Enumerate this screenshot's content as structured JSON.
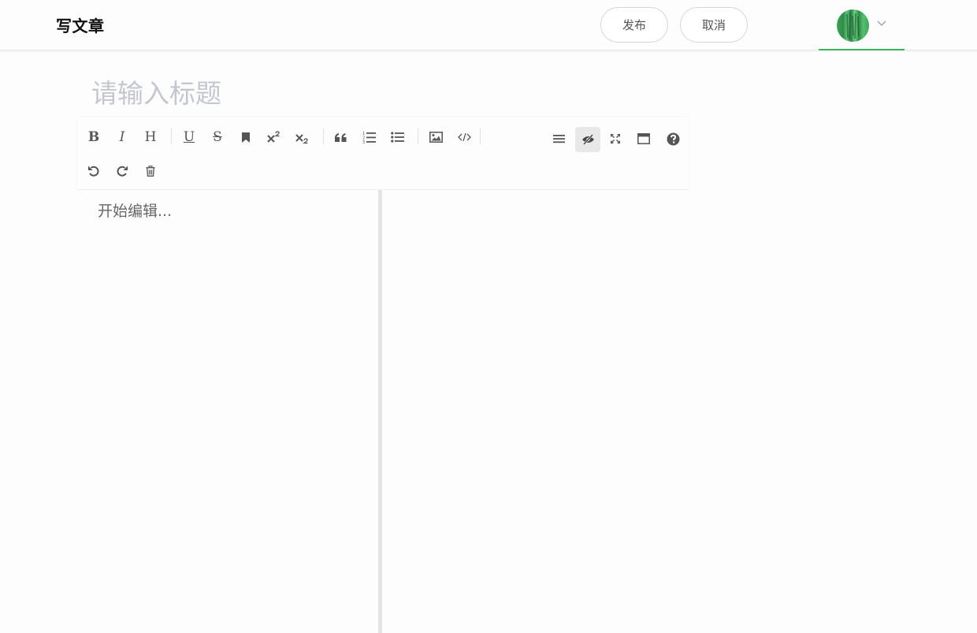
{
  "header": {
    "title": "写文章",
    "publish_label": "发布",
    "cancel_label": "取消",
    "accent_color": "#3fb25a"
  },
  "title_field": {
    "placeholder": "请输入标题",
    "value": ""
  },
  "editor": {
    "placeholder": "开始编辑...",
    "value": "",
    "toolbar": {
      "left_groups": [
        [
          "bold",
          "italic",
          "header"
        ],
        [
          "underline",
          "strikethrough",
          "mark",
          "superscript",
          "subscript"
        ],
        [
          "quote",
          "ordered-list",
          "unordered-list"
        ],
        [
          "image",
          "code"
        ]
      ],
      "right_items": [
        "navigation",
        "preview-toggle",
        "fullscreen",
        "read-mode",
        "help"
      ],
      "second_row": [
        "undo",
        "redo",
        "trash"
      ],
      "active_item": "preview-toggle",
      "bold_glyph": "B",
      "italic_glyph": "I",
      "header_glyph": "H",
      "underline_glyph": "U",
      "strike_glyph": "S"
    }
  }
}
